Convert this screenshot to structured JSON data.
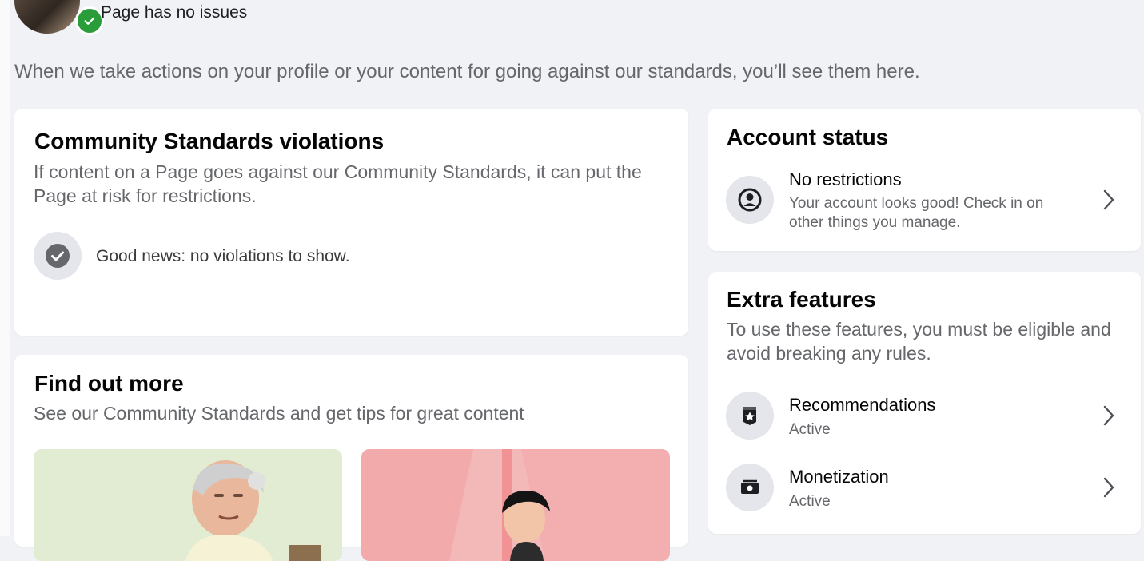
{
  "header": {
    "status_text": "Page has no issues"
  },
  "intro_text": "When we take actions on your profile or your content for going against our standards, you’ll see them here.",
  "community_standards": {
    "title": "Community Standards violations",
    "description": "If content on a Page goes against our Community Standards, it can put the Page at risk for restrictions.",
    "status_message": "Good news: no violations to show."
  },
  "find_out_more": {
    "title": "Find out more",
    "description": "See our Community Standards and get tips for great content"
  },
  "account_status": {
    "title": "Account status",
    "item": {
      "title": "No restrictions",
      "description": "Your account looks good! Check in on other things you manage."
    }
  },
  "extra_features": {
    "title": "Extra features",
    "description": "To use these features, you must be eligible and avoid breaking any rules.",
    "items": [
      {
        "title": "Recommendations",
        "status": "Active",
        "icon": "badge-icon"
      },
      {
        "title": "Monetization",
        "status": "Active",
        "icon": "money-icon"
      }
    ]
  },
  "colors": {
    "page_background": "#f0f2f5",
    "card_background": "#ffffff",
    "success_green": "#2a9d3a",
    "secondary_text": "#65676b"
  }
}
